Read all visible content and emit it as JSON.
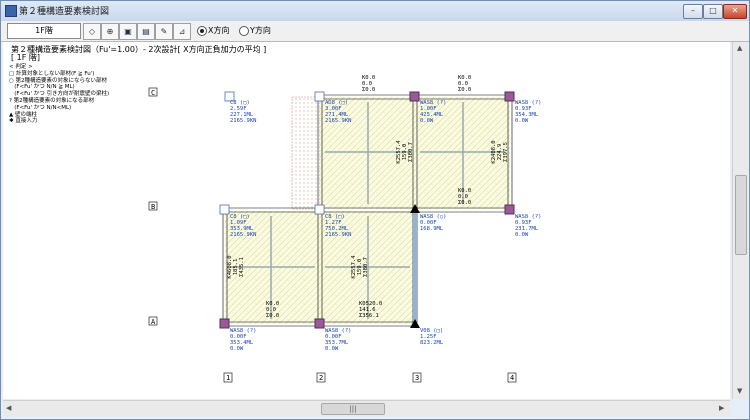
{
  "window": {
    "title": "第２種構造要素検討図",
    "min": "–",
    "max": "□",
    "close": "✕"
  },
  "toolbar": {
    "floor": "1F階",
    "icons": [
      "diamond-nav-icon",
      "zoom-icon",
      "fit-icon",
      "print-icon",
      "paint-icon",
      "ruler-icon"
    ],
    "radio_x": "X方向",
    "radio_y": "Y方向",
    "selected": "X方向"
  },
  "drawing": {
    "heading": "第２種構造要素検討図（Fu'=1.00）- 2次設計[ X方向正負加力の平均 ]",
    "subhead": "[ 1F 階]",
    "legend": "< 判定 >\n□ 計算対象としない部材(F ≧ Fu')\n○ 第2種構造要素の対象にならない部材\n   (F<Fu' かつ N/N ≧ ML)\n   (F<Fu' かつ 引き方向が耐震壁の梁柱)\n? 第2種構造要素の対象になる部材\n   (F<Fu' かつ N/N<ML)\n▲ 壁の端柱\n✱ 直接入力",
    "grid_rows": [
      "C",
      "B",
      "A"
    ],
    "grid_cols": [
      "1",
      "2",
      "3",
      "4"
    ],
    "top_loads": [
      [
        "K0.0",
        "0.0",
        "Σ0.0"
      ],
      [
        "K0.0",
        "0.0",
        "Σ0.0"
      ]
    ],
    "mid_load": [
      "K0.0",
      "0.0",
      "Σ0.0"
    ],
    "bot_loads": [
      [
        "K0.0",
        "0.0",
        "Σ0.0"
      ],
      [
        "K0520.0",
        "141.6",
        "Σ356.1"
      ]
    ],
    "wall_labels": [
      [
        "K2557.4",
        "159.0",
        "Σ380.7"
      ],
      [
        "K2408.0",
        "224.9",
        "Σ397.5"
      ],
      [
        "K2557.4",
        "159.0",
        "Σ380.7"
      ],
      [
        "K4608.0",
        "185.1",
        "Σ435.1"
      ]
    ],
    "columns": {
      "C1": [
        "C8 (□)",
        "2.59F",
        "227.1ML",
        "2165.9KN"
      ],
      "C2": [
        "AD8 (□)",
        "3.00F",
        "271.4ML",
        "2165.9KN"
      ],
      "C3": [
        "WAS8 (?)",
        "1.00F",
        "425.4ML",
        "0.0W"
      ],
      "C4": [
        "WAS8 (?)",
        "0.93F",
        "354.3ML",
        "0.0W"
      ],
      "B1": [
        "C8 (□)",
        "1.09F",
        "353.9ML",
        "2165.9KN"
      ],
      "B2": [
        "C8 (□)",
        "1.27F",
        "750.2ML",
        "2165.9KN"
      ],
      "B3": [
        "WAS8 (○)",
        "0.00F",
        "168.9ML"
      ],
      "B4": [
        "WAS8 (?)",
        "0.93F",
        "231.7ML",
        "0.0W"
      ],
      "A1": [
        "WAS8 (?)",
        "0.00F",
        "353.4ML",
        "0.0W"
      ],
      "A2": [
        "WAS8 (?)",
        "0.00F",
        "353.7ML",
        "0.0W"
      ],
      "A3": [
        "V08 (□)",
        "1.25F",
        "823.2ML"
      ]
    }
  }
}
